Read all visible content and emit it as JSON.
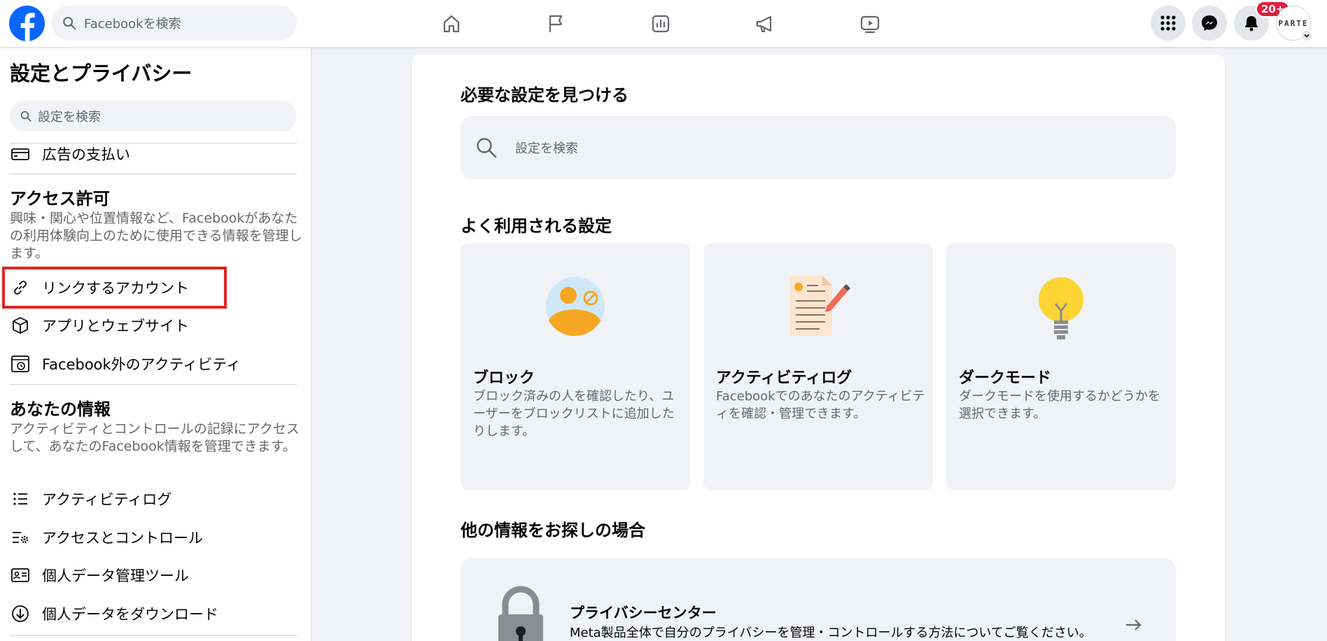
{
  "topbar": {
    "search_placeholder": "Facebookを検索",
    "notification_badge": "20+",
    "avatar_text": "PARTE"
  },
  "sidebar": {
    "title": "設定とプライバシー",
    "search_placeholder": "設定を検索",
    "ad_payments": "広告の支払い",
    "access": {
      "title": "アクセス許可",
      "description": "興味・関心や位置情報など、Facebookがあなたの利用体験向上のために使用できる情報を管理します。",
      "items": [
        {
          "label": "リンクするアカウント",
          "icon": "link-icon"
        },
        {
          "label": "アプリとウェブサイト",
          "icon": "box-icon"
        },
        {
          "label": "Facebook外のアクティビティ",
          "icon": "history-icon"
        }
      ]
    },
    "your_info": {
      "title": "あなたの情報",
      "description": "アクティビティとコントロールの記録にアクセスして、あなたのFacebook情報を管理できます。",
      "items": [
        {
          "label": "アクティビティログ",
          "icon": "list-icon"
        },
        {
          "label": "アクセスとコントロール",
          "icon": "list-gear-icon"
        },
        {
          "label": "個人データ管理ツール",
          "icon": "id-card-icon"
        },
        {
          "label": "個人データをダウンロード",
          "icon": "download-icon"
        }
      ]
    }
  },
  "main": {
    "find_title": "必要な設定を見つける",
    "search_placeholder": "設定を検索",
    "common_title": "よく利用される設定",
    "tiles": [
      {
        "title": "ブロック",
        "description": "ブロック済みの人を確認したり、ユーザーをブロックリストに追加したりします。"
      },
      {
        "title": "アクティビティログ",
        "description": "Facebookでのあなたのアクティビティを確認・管理できます。"
      },
      {
        "title": "ダークモード",
        "description": "ダークモードを使用するかどうかを選択できます。"
      }
    ],
    "other_title": "他の情報をお探しの場合",
    "privacy_center": {
      "title": "プライバシーセンター",
      "description": "Meta製品全体で自分のプライバシーを管理・コントロールする方法についてご覧ください。"
    }
  },
  "colors": {
    "brand_blue": "#0866ff",
    "highlight_red": "#e02424",
    "badge_red": "#e41e3f"
  }
}
